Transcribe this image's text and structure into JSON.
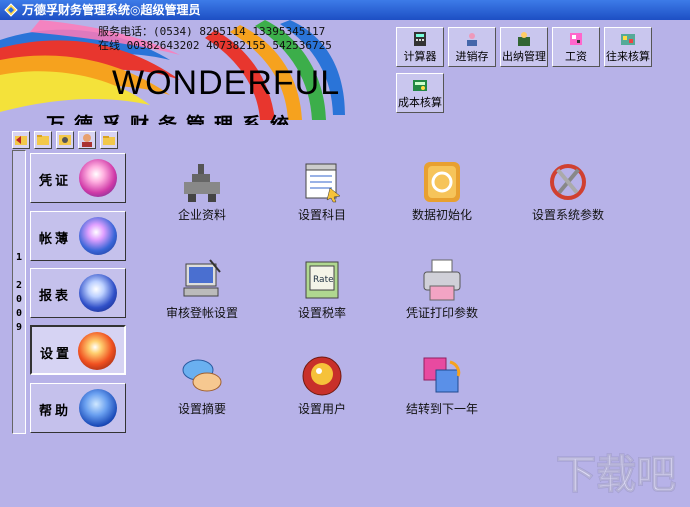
{
  "window": {
    "title": "万德孚财务管理系统◎超级管理员",
    "bg": "#b7b2e8"
  },
  "banner": {
    "phone_line": "服务电话：(0534) 8295114 13395345117",
    "online_line": "在线 00382643202 407382155 542536725",
    "brand": "WONDERFUL",
    "system_name": "万德孚财务管理系统"
  },
  "toolbar": [
    {
      "id": "calculator",
      "label": "计算器",
      "icon": "calculator-icon"
    },
    {
      "id": "inventory",
      "label": "进销存",
      "icon": "inventory-icon"
    },
    {
      "id": "cashier",
      "label": "出纳管理",
      "icon": "cashier-icon"
    },
    {
      "id": "salary",
      "label": "工资",
      "icon": "salary-icon"
    },
    {
      "id": "accounts",
      "label": "往来核算",
      "icon": "accounts-icon"
    },
    {
      "id": "cost",
      "label": "成本核算",
      "icon": "cost-icon"
    }
  ],
  "nav": [
    {
      "id": "voucher",
      "label": "凭证",
      "active": false
    },
    {
      "id": "ledger",
      "label": "帐薄",
      "active": false
    },
    {
      "id": "report",
      "label": "报表",
      "active": false
    },
    {
      "id": "settings",
      "label": "设置",
      "active": true
    },
    {
      "id": "help",
      "label": "帮助",
      "active": false
    }
  ],
  "year_label": "1 2009",
  "year_chars": [
    "1",
    "",
    "2",
    "0",
    "0",
    "9"
  ],
  "main_items": [
    {
      "id": "company",
      "label": "企业资料",
      "icon": "company-icon"
    },
    {
      "id": "subjects",
      "label": "设置科目",
      "icon": "data-table-icon"
    },
    {
      "id": "init",
      "label": "数据初始化",
      "icon": "database-init-icon"
    },
    {
      "id": "sysparams",
      "label": "设置系统参数",
      "icon": "tools-icon"
    },
    {
      "id": "audit",
      "label": "审核登帐设置",
      "icon": "computer-icon"
    },
    {
      "id": "taxrate",
      "label": "设置税率",
      "icon": "rate-icon"
    },
    {
      "id": "printparams",
      "label": "凭证打印参数",
      "icon": "printer-icon"
    },
    {
      "id": "summary",
      "label": "设置摘要",
      "icon": "chat-icon"
    },
    {
      "id": "users",
      "label": "设置用户",
      "icon": "user-icon"
    },
    {
      "id": "nextyear",
      "label": "结转到下一年",
      "icon": "carry-over-icon"
    }
  ],
  "watermark": "下载吧"
}
